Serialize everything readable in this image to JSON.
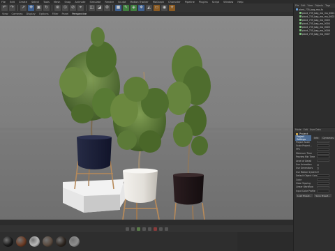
{
  "menubar": {
    "items": [
      "File",
      "Edit",
      "Create",
      "Select",
      "Tools",
      "Mesh",
      "Snap",
      "Animate",
      "Simulate",
      "Render",
      "Sculpt",
      "Motion Tracker",
      "MoGraph",
      "Character",
      "Pipeline",
      "Plugins",
      "Script",
      "Window",
      "Help"
    ]
  },
  "viewport_menu": {
    "items": [
      "View",
      "Cameras",
      "Display",
      "Options",
      "Filter",
      "Panel"
    ],
    "active_label": "Perspective"
  },
  "objects_panel": {
    "tabs": [
      "File",
      "Edit",
      "View",
      "Objects",
      "Tags"
    ],
    "root": "plant_735_bag_ma_fo",
    "children": [
      "plant_735_bag_ma_ma_0001",
      "plant_735_bag_ma_ma_0002",
      "plant_735_bag_ma_0003",
      "plant_735_bag_ma_0004",
      "plant_735_bag_ma_0005",
      "plant_735_bag_ma_0006",
      "plant_735_bag_ma_0007"
    ]
  },
  "attributes_panel": {
    "tabs": [
      "Mode",
      "Edit",
      "User Data"
    ],
    "title": "Project",
    "subtabs": [
      "Project Settings",
      "Info",
      "Dynamics"
    ],
    "rows": [
      "Project Scale",
      "Scale Project...",
      "FPS",
      "Minimum Time",
      "Preview Min Time",
      "Level of Detail",
      "Use Animation",
      "Use Generators",
      "Use Motion System",
      "Default Object Color",
      "Color",
      "View Clipping",
      "Linear Workflow",
      "Input Color Profile"
    ],
    "buttons": [
      "Load Preset...",
      "Save Preset..."
    ]
  },
  "materials": {
    "swatches": [
      "#1b1b1b",
      "#6b3b24",
      "#b9b9b9",
      "#5a4a3e",
      "#2e2620",
      "#8f8f8f"
    ]
  },
  "colors": {
    "pot_dark": "#1c1f33",
    "pot_white": "#e8e6e2",
    "pot_black": "#1e1517",
    "stand_wood": "#b78a5a",
    "foliage": "#5c7a38"
  }
}
